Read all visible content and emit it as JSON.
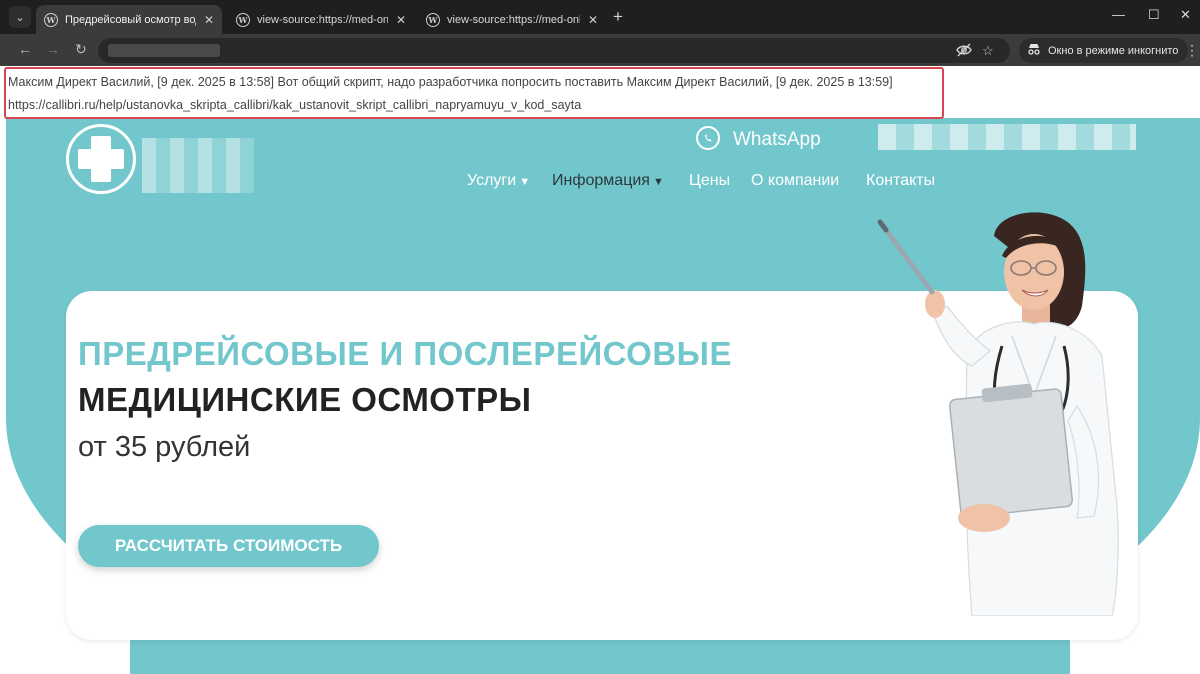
{
  "browser": {
    "tab_menu_glyph": "⌄",
    "tabs": [
      {
        "title": "Предрейсовый осмотр водит",
        "close": "✕"
      },
      {
        "title": "view-source:https://med-online",
        "close": "✕"
      },
      {
        "title": "view-source:https://med-online",
        "close": "✕"
      }
    ],
    "tab_favicon": "W",
    "new_tab": "+",
    "window_controls": {
      "minimize": "—",
      "maximize": "☐",
      "close": "✕"
    },
    "nav": {
      "back": "←",
      "forward": "→",
      "reload": "↻"
    },
    "incognito_label": "Окно в режиме инкогнито",
    "menu_glyph": "⋮"
  },
  "note": {
    "line1": "Максим Директ Василий, [9 дек. 2025 в 13:58] Вот общий скрипт, надо разработчика попросить поставить Максим Директ Василий, [9 дек. 2025 в 13:59]",
    "line2": "https://callibri.ru/help/ustanovka_skripta_callibri/kak_ustanovit_skript_callibri_napryamuyu_v_kod_sayta"
  },
  "site": {
    "whatsapp_label": "WhatsApp",
    "menu": [
      {
        "label": "Услуги",
        "chevron": "⌄"
      },
      {
        "label": "Информация",
        "chevron": "⌄"
      },
      {
        "label": "Цены"
      },
      {
        "label": "О компании"
      },
      {
        "label": "Контакты"
      }
    ],
    "hero": {
      "title_line1": "ПРЕДРЕЙСОВЫЕ И ПОСЛЕРЕЙСОВЫЕ",
      "title_line2": "МЕДИЦИНСКИЕ ОСМОТРЫ",
      "price": "от 35 рублей",
      "cta": "РАССЧИТАТЬ СТОИМОСТЬ"
    },
    "colors": {
      "brand_teal": "#72c7cc",
      "dark_text": "#222222",
      "highlight_border": "#d64550"
    }
  }
}
